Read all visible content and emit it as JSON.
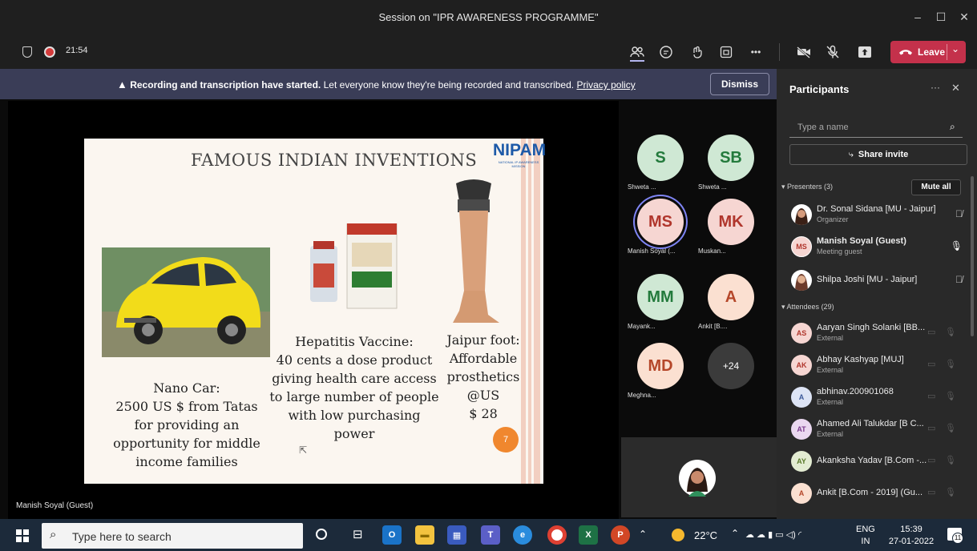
{
  "window": {
    "title": "Session on \"IPR AWARENESS PROGRAMME\"",
    "minimize": "–",
    "maximize": "☐",
    "close": "✕"
  },
  "toolbar": {
    "timer": "21:54",
    "leave_label": "Leave",
    "more": "•••"
  },
  "banner": {
    "bold": "Recording and transcription have started.",
    "text": "Let everyone know they're being recorded and transcribed.",
    "link": "Privacy policy",
    "dismiss": "Dismiss"
  },
  "slide": {
    "title": "FAMOUS INDIAN INVENTIONS",
    "logo": "NIPAM",
    "logo_sub": "NATIONAL IP AWARENESS MISSION",
    "items": [
      {
        "lines": [
          "Nano Car:",
          "2500 US $  from Tatas",
          "for providing an",
          "opportunity for middle",
          "income families"
        ]
      },
      {
        "lines": [
          "Hepatitis Vaccine:",
          "40 cents a dose product",
          "giving health care access",
          "to large number of people",
          "with low purchasing",
          "power"
        ]
      },
      {
        "lines": [
          "Jaipur foot:",
          "Affordable",
          "prosthetics",
          "@US",
          "$ 28"
        ]
      }
    ],
    "page": "7"
  },
  "stage": {
    "presenter_label": "Manish Soyal (Guest)"
  },
  "tiles": [
    {
      "initials": "S",
      "name": "Shweta ...",
      "bg": "#cfe8d4",
      "fg": "#237a3c"
    },
    {
      "initials": "SB",
      "name": "Shweta ...",
      "bg": "#cfe8d4",
      "fg": "#237a3c"
    },
    {
      "initials": "MS",
      "name": "Manish Soyal (...",
      "bg": "#f6d6d2",
      "fg": "#b0362c"
    },
    {
      "initials": "MK",
      "name": "Muskan...",
      "bg": "#f6d6d2",
      "fg": "#b0362c"
    },
    {
      "initials": "MM",
      "name": "Mayank...",
      "bg": "#cfe8d4",
      "fg": "#237a3c"
    },
    {
      "initials": "A",
      "name": "Ankit [B....",
      "bg": "#fbe0d1",
      "fg": "#b5472a"
    },
    {
      "initials": "MD",
      "name": "Meghna...",
      "bg": "#fbe0d1",
      "fg": "#b5472a"
    },
    {
      "initials": "+24",
      "name": "",
      "bg": "#3b3b3b",
      "fg": "#ffffff"
    }
  ],
  "panel": {
    "title": "Participants",
    "more": "···",
    "close": "✕",
    "search_placeholder": "Type a name",
    "share_invite": "Share invite",
    "presenters_header": "Presenters (3)",
    "mute_all": "Mute all",
    "attendees_header": "Attendees (29)",
    "presenters": [
      {
        "name": "Dr. Sonal Sidana [MU - Jaipur]",
        "role": "Organizer"
      },
      {
        "name": "Manish Soyal (Guest)",
        "role": "Meeting guest",
        "initials": "MS"
      },
      {
        "name": "Shilpa Joshi [MU - Jaipur]",
        "role": ""
      }
    ],
    "attendees": [
      {
        "initials": "AS",
        "name": "Aaryan Singh Solanki [BB...",
        "role": "External"
      },
      {
        "initials": "AK",
        "name": "Abhay Kashyap [MUJ]",
        "role": "External"
      },
      {
        "initials": "A",
        "name": "abhinav.200901068",
        "role": "External"
      },
      {
        "initials": "AT",
        "name": "Ahamed Ali Talukdar [B C...",
        "role": "External"
      },
      {
        "initials": "AY",
        "name": "Akanksha Yadav [B.Com -...",
        "role": ""
      },
      {
        "initials": "A",
        "name": "Ankit [B.Com - 2019] (Gu...",
        "role": ""
      }
    ]
  },
  "taskbar": {
    "search_placeholder": "Type here to search",
    "temperature": "22°C",
    "language": "ENG",
    "region": "IN",
    "time": "15:39",
    "date": "27-01-2022",
    "notif_count": "11"
  }
}
